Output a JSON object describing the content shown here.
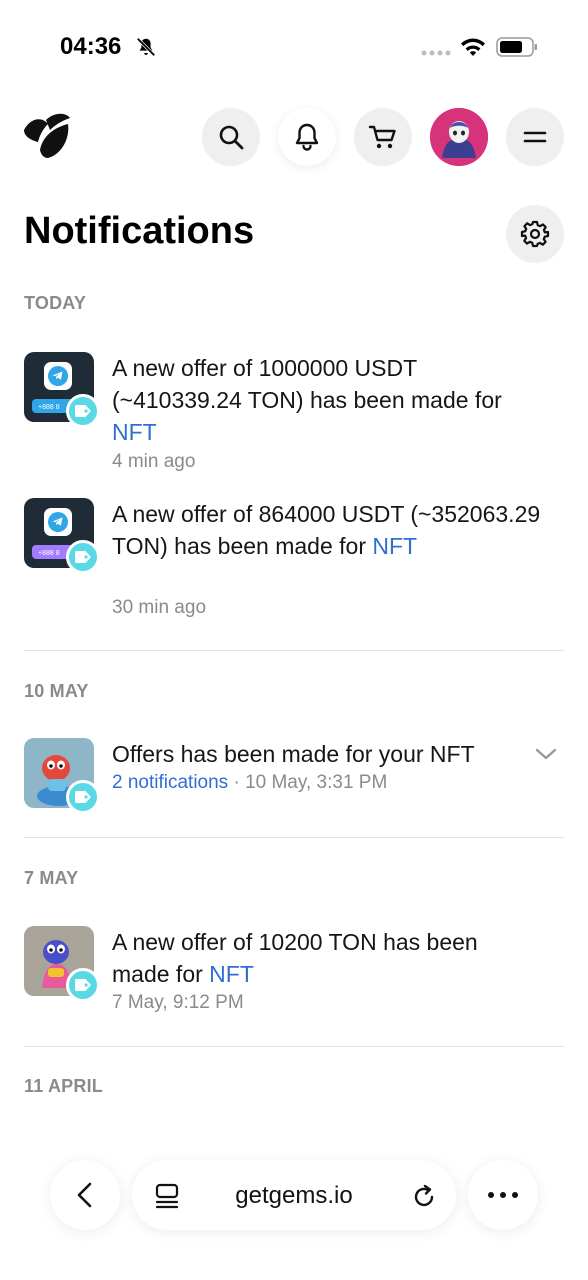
{
  "status_bar": {
    "time": "04:36",
    "icons": [
      "bell-slash-icon",
      "signal-dots-icon",
      "wifi-icon",
      "battery-icon"
    ]
  },
  "header": {
    "logo": "getgems-logo",
    "buttons": [
      "search-icon",
      "bell-icon",
      "cart-icon",
      "avatar",
      "menu-icon"
    ]
  },
  "page": {
    "title": "Notifications",
    "settings_icon": "gear-icon"
  },
  "sections": [
    {
      "label": "TODAY",
      "items": [
        {
          "text": "A new offer of 1000000 USDT (~410339.24 TON) has been made for ",
          "link": "NFT",
          "time": "4 min ago",
          "thumb": "telegram-number-nft",
          "thumb_strip": "+888 8",
          "strip_color": "#2ea6e8"
        },
        {
          "text": "A new offer of 864000 USDT (~352063.29 TON) has been made for ",
          "link": "NFT",
          "time": "30 min ago",
          "thumb": "telegram-number-nft",
          "thumb_strip": "+888 8",
          "strip_color": "#a37bff"
        }
      ]
    },
    {
      "label": "10 MAY",
      "items": [
        {
          "text": "Offers has been made for your NFT",
          "sub_link": "2 notifications",
          "sub_rest": " · 10 May, 3:31 PM",
          "thumb": "red-creature-nft",
          "expand_icon": "chevron-down-icon"
        }
      ]
    },
    {
      "label": "7 MAY",
      "items": [
        {
          "text": "A new offer of 10200 TON has been made for ",
          "link": "NFT",
          "time": "7 May, 9:12 PM",
          "thumb": "blue-creature-nft"
        }
      ]
    },
    {
      "label": "11 APRIL",
      "items": []
    }
  ],
  "browser_bar": {
    "url": "getgems.io",
    "icons": [
      "back-arrow-icon",
      "tabs-icon",
      "reload-icon",
      "more-icon"
    ]
  },
  "colors": {
    "accent_link": "#2f6fd4",
    "badge": "#59d8e6",
    "avatar_bg": "#d6337a"
  }
}
